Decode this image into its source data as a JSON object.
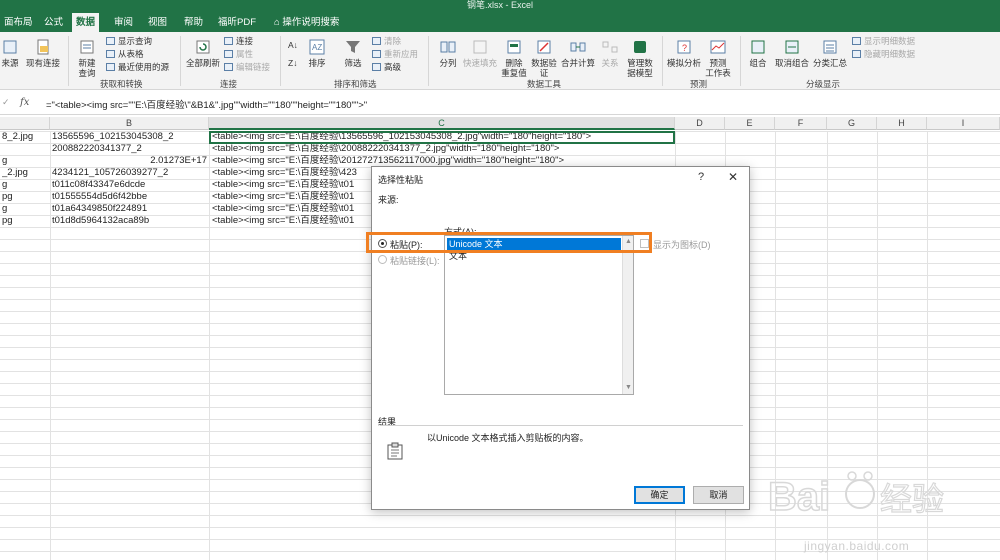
{
  "window": {
    "title": "钢笔.xlsx - Excel"
  },
  "tabs": [
    "面布局",
    "公式",
    "数据",
    "审阅",
    "视图",
    "帮助",
    "福昕PDF",
    "操作说明搜索"
  ],
  "active_tab": "数据",
  "ribbon": {
    "get_data": {
      "from_source": "来源",
      "existing_conn": "现有连接",
      "new_query": "新建\n查询",
      "show_query": "显示查询",
      "from_table": "从表格",
      "recent_sources": "最近使用的源",
      "group": "获取和转换"
    },
    "connections": {
      "refresh_all": "全部刷新",
      "connections": "连接",
      "properties": "属性",
      "edit_links": "编辑链接",
      "group": "连接"
    },
    "sort_filter": {
      "sort": "排序",
      "filter": "筛选",
      "clear": "清除",
      "reapply": "重新应用",
      "advanced": "高级",
      "group": "排序和筛选"
    },
    "data_tools": {
      "text_to_columns": "分列",
      "flash_fill": "快速填充",
      "remove_duplicates": "删除\n重复值",
      "data_validation": "数据验\n证",
      "consolidate": "合并计算",
      "relationships": "关系",
      "manage_model": "管理数\n据模型",
      "group": "数据工具"
    },
    "forecast": {
      "what_if": "模拟分析",
      "forecast_sheet": "预测\n工作表",
      "group": "预测"
    },
    "outline": {
      "group_btn": "组合",
      "ungroup": "取消组合",
      "subtotal": "分类汇总",
      "show_detail": "显示明细数据",
      "hide_detail": "隐藏明细数据",
      "group": "分级显示"
    }
  },
  "formula_bar": {
    "fx": "fx",
    "formula": "=\"<table><img src=\"\"E:\\百度经验\\\"&B1&\".jpg\"\"width=\"\"180\"\"height=\"\"180\"\">\""
  },
  "columns": [
    "B",
    "C",
    "D",
    "E",
    "F",
    "G",
    "H",
    "I"
  ],
  "rows": [
    {
      "a": "8_2.jpg",
      "b": "13565596_102153045308_2",
      "c": "<table><img src=\"E:\\百度经验\\13565596_102153045308_2.jpg\"width=\"180\"height=\"180\">"
    },
    {
      "a": "",
      "b": "200882220341377_2",
      "c": "<table><img src=\"E:\\百度经验\\200882220341377_2.jpg\"width=\"180\"height=\"180\">"
    },
    {
      "a": "g",
      "b": "2.01273E+17",
      "c": "<table><img src=\"E:\\百度经验\\201272713562117000.jpg\"width=\"180\"height=\"180\">"
    },
    {
      "a": "_2.jpg",
      "b": "4234121_105726039277_2",
      "c": "<table><img src=\"E:\\百度经验\\423"
    },
    {
      "a": "g",
      "b": "t011c08f43347e6dcde",
      "c": "<table><img src=\"E:\\百度经验\\t01"
    },
    {
      "a": "pg",
      "b": "t01555554d5d6f42bbe",
      "c": "<table><img src=\"E:\\百度经验\\t01"
    },
    {
      "a": "g",
      "b": "t01a64349850f224891",
      "c": "<table><img src=\"E:\\百度经验\\t01"
    },
    {
      "a": "pg",
      "b": "t01d8d5964132aca89b",
      "c": "<table><img src=\"E:\\百度经验\\t01"
    }
  ],
  "dialog": {
    "title": "选择性粘贴",
    "help": "?",
    "close": "✕",
    "source_label": "来源:",
    "as_label": "方式(A):",
    "paste_label": "粘贴(P):",
    "paste_link_label": "粘贴链接(L):",
    "options": [
      "Unicode 文本",
      "文本"
    ],
    "selected_option": "Unicode 文本",
    "display_as_icon": "显示为图标(D)",
    "result_label": "结果",
    "result_text": "以Unicode 文本格式插入剪贴板的内容。",
    "ok": "确定",
    "cancel": "取消"
  },
  "colors": {
    "excel_green": "#217346",
    "highlight_orange": "#f07f22",
    "selection_blue": "#0078d7"
  },
  "watermark": {
    "text": "jingyan.baidu.com",
    "brand": "Bai经验"
  }
}
